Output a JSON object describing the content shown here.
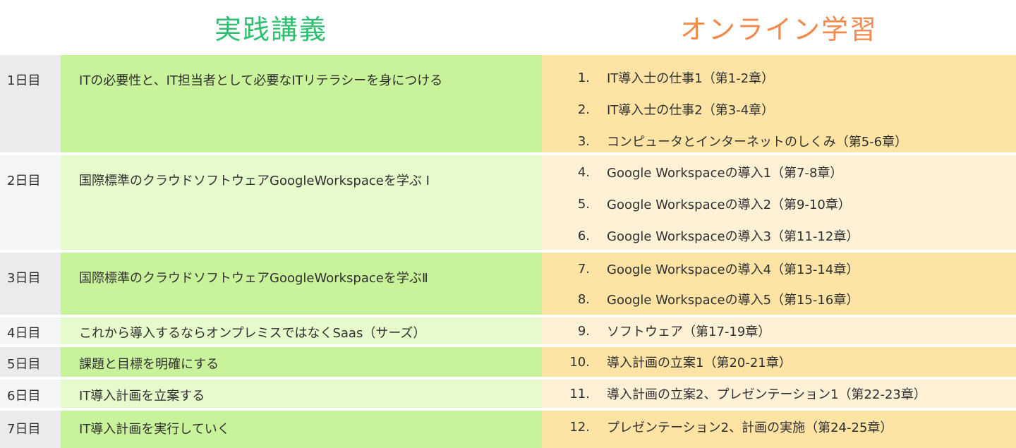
{
  "headers": {
    "lecture": "実践講義",
    "online": "オンライン学習"
  },
  "days": [
    {
      "day": "1日目",
      "lecture": "ITの必要性と、IT担当者として必要なITリテラシーを身につける"
    },
    {
      "day": "2日目",
      "lecture": "国際標準のクラウドソフトウェアGoogleWorkspaceを学ぶ Ⅰ"
    },
    {
      "day": "3日目",
      "lecture": "国際標準のクラウドソフトウェアGoogleWorkspaceを学ぶⅡ"
    },
    {
      "day": "4日目",
      "lecture": "これから導入するならオンプレミスではなくSaas（サーズ）"
    },
    {
      "day": "5日目",
      "lecture": "課題と目標を明確にする"
    },
    {
      "day": "6日目",
      "lecture": "IT導入計画を立案する"
    },
    {
      "day": "7日目",
      "lecture": "IT導入計画を実行していく"
    }
  ],
  "online": [
    {
      "num": "1.",
      "text": "IT導入士の仕事1（第1-2章）"
    },
    {
      "num": "2.",
      "text": "IT導入士の仕事2（第3-4章）"
    },
    {
      "num": "3.",
      "text": "コンピュータとインターネットのしくみ（第5-6章）"
    },
    {
      "num": "4.",
      "text": "Google Workspaceの導入1（第7-8章）"
    },
    {
      "num": "5.",
      "text": "Google Workspaceの導入2（第9-10章）"
    },
    {
      "num": "6.",
      "text": "Google Workspaceの導入3（第11-12章）"
    },
    {
      "num": "7.",
      "text": "Google Workspaceの導入4（第13-14章）"
    },
    {
      "num": "8.",
      "text": "Google Workspaceの導入5（第15-16章）"
    },
    {
      "num": "9.",
      "text": "ソフトウェア（第17-19章）"
    },
    {
      "num": "10.",
      "text": "導入計画の立案1（第20-21章）"
    },
    {
      "num": "11.",
      "text": "導入計画の立案2、プレゼンテーション1（第22-23章）"
    },
    {
      "num": "12.",
      "text": "プレゼンテーション2、計画の実施（第24-25章）"
    }
  ],
  "colors": {
    "lecture_header": "#2dbf6f",
    "online_header": "#f3894a",
    "lecture_dark": "#c9f39a",
    "lecture_light": "#e6fbcc",
    "online_dark": "#fde3a4",
    "online_light": "#fff1d5"
  }
}
